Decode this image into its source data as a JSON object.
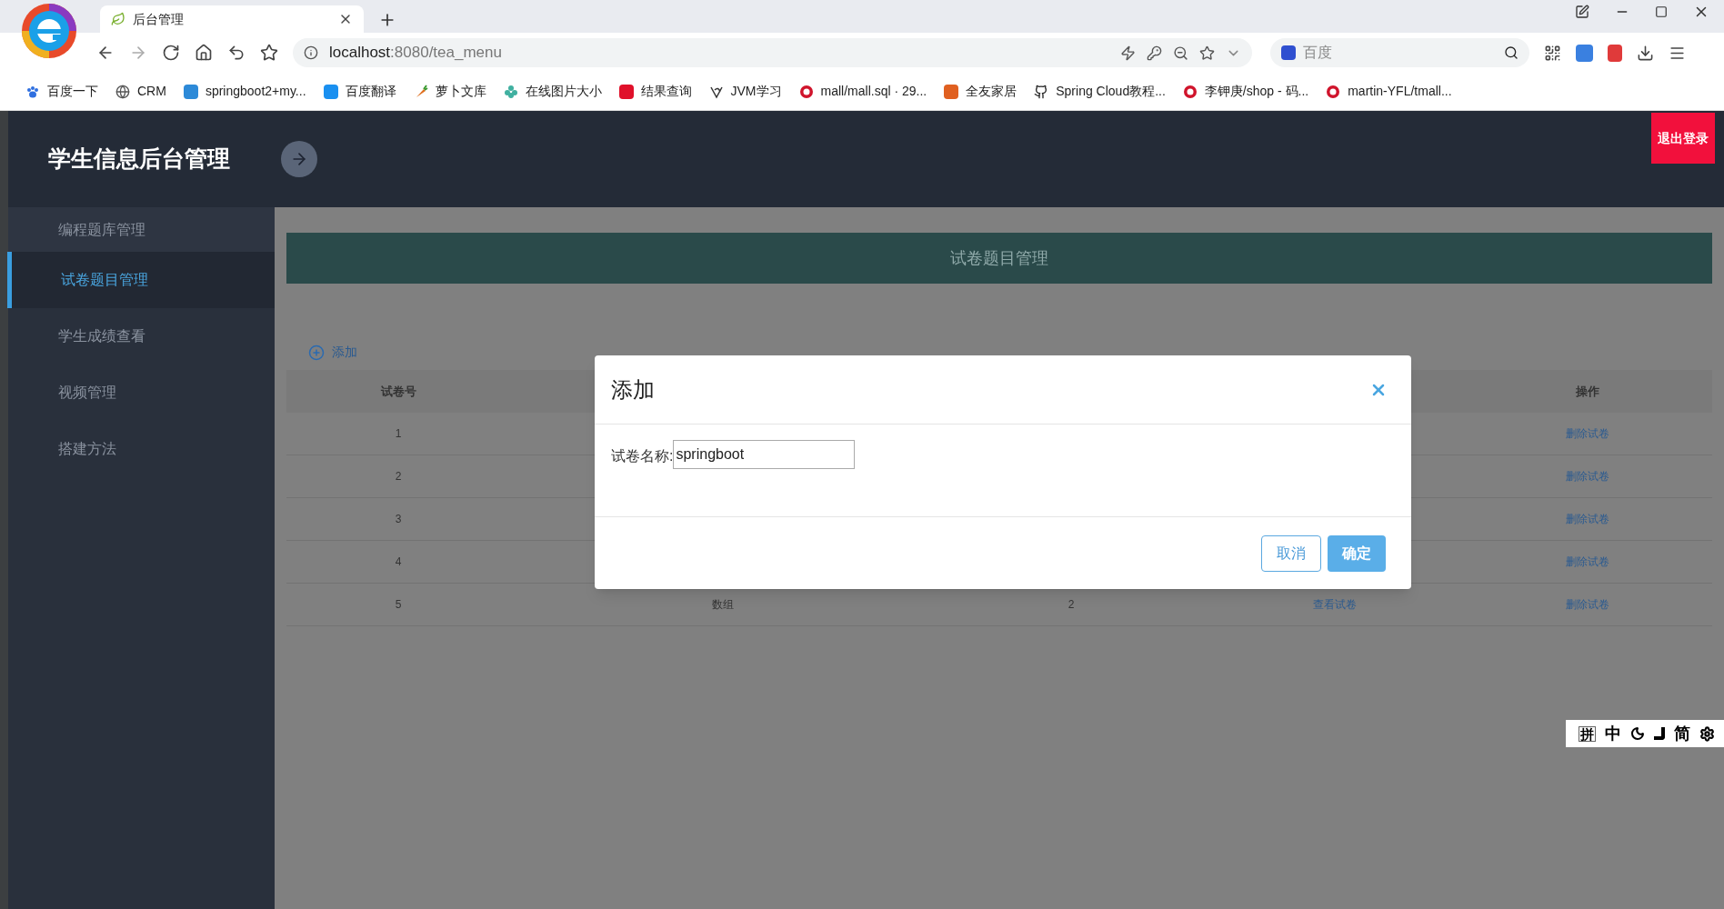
{
  "browser": {
    "tab": {
      "title": "后台管理"
    },
    "url": {
      "host": "localhost",
      "rest": ":8080/tea_menu"
    },
    "search": {
      "placeholder": "百度"
    },
    "bookmarks": [
      "百度一下",
      "CRM",
      "springboot2+my...",
      "百度翻译",
      "萝卜文库",
      "在线图片大小",
      "结果查询",
      "JVM学习",
      "mall/mall.sql · 29...",
      "全友家居",
      "Spring Cloud教程...",
      "李钾庚/shop - 码...",
      "martin-YFL/tmall..."
    ]
  },
  "app": {
    "title": "学生信息后台管理",
    "logout": "退出登录",
    "sidebar": {
      "items": [
        {
          "label": "编程题库管理",
          "selected": false
        },
        {
          "label": "试卷题目管理",
          "selected": true
        },
        {
          "label": "学生成绩查看",
          "selected": false
        },
        {
          "label": "视频管理",
          "selected": false
        },
        {
          "label": "搭建方法",
          "selected": false
        }
      ]
    },
    "banner": "试卷题目管理",
    "add_button": "添加",
    "table": {
      "header": {
        "column_1": "试卷号",
        "column_5": "操作"
      },
      "rows": [
        {
          "column_1": "1",
          "column_5": "删除试卷"
        },
        {
          "column_1": "2",
          "column_5": "删除试卷"
        },
        {
          "column_1": "3",
          "column_5": "删除试卷"
        },
        {
          "column_1": "4",
          "column_5": "删除试卷"
        },
        {
          "column_1": "5",
          "column_2": "数组",
          "column_3": "2",
          "column_4": "查看试卷",
          "column_5": "删除试卷"
        }
      ]
    }
  },
  "dialog": {
    "title": "添加",
    "field_label": "试卷名称:",
    "field_value": "springboot",
    "cancel": "取消",
    "confirm": "确定"
  },
  "ime_bar": {
    "items": [
      "拼",
      "中",
      "简"
    ]
  }
}
